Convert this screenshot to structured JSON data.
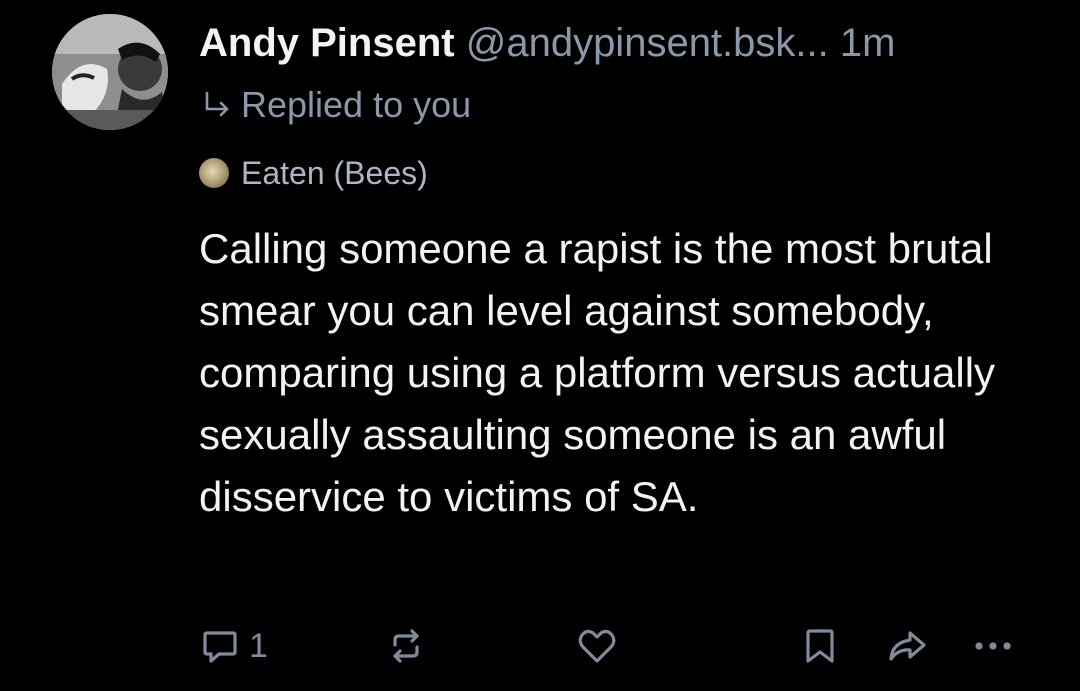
{
  "post": {
    "author": {
      "display_name": "Andy Pinsent",
      "handle": "@andypinsent.bsk...",
      "avatar_icon": "avatar-photo"
    },
    "timestamp": "1m",
    "reply_context": {
      "icon": "reply-arrow-icon",
      "text": "Replied to you"
    },
    "quoted_author": {
      "name": "Eaten (Bees)",
      "avatar_icon": "mini-avatar"
    },
    "text": "Calling someone a rapist is the most brutal smear you can level against somebody, comparing using a platform versus actually sexually assaulting someone is an awful disservice to victims of SA.",
    "actions": {
      "reply_count": "1",
      "icons": [
        "reply-icon",
        "repost-icon",
        "like-icon",
        "bookmark-icon",
        "share-icon",
        "more-icon"
      ]
    }
  },
  "colors": {
    "background": "#000000",
    "primary_text": "#f1f3f5",
    "secondary_text": "#8b98a9",
    "action_icon": "#7f8b9b"
  }
}
